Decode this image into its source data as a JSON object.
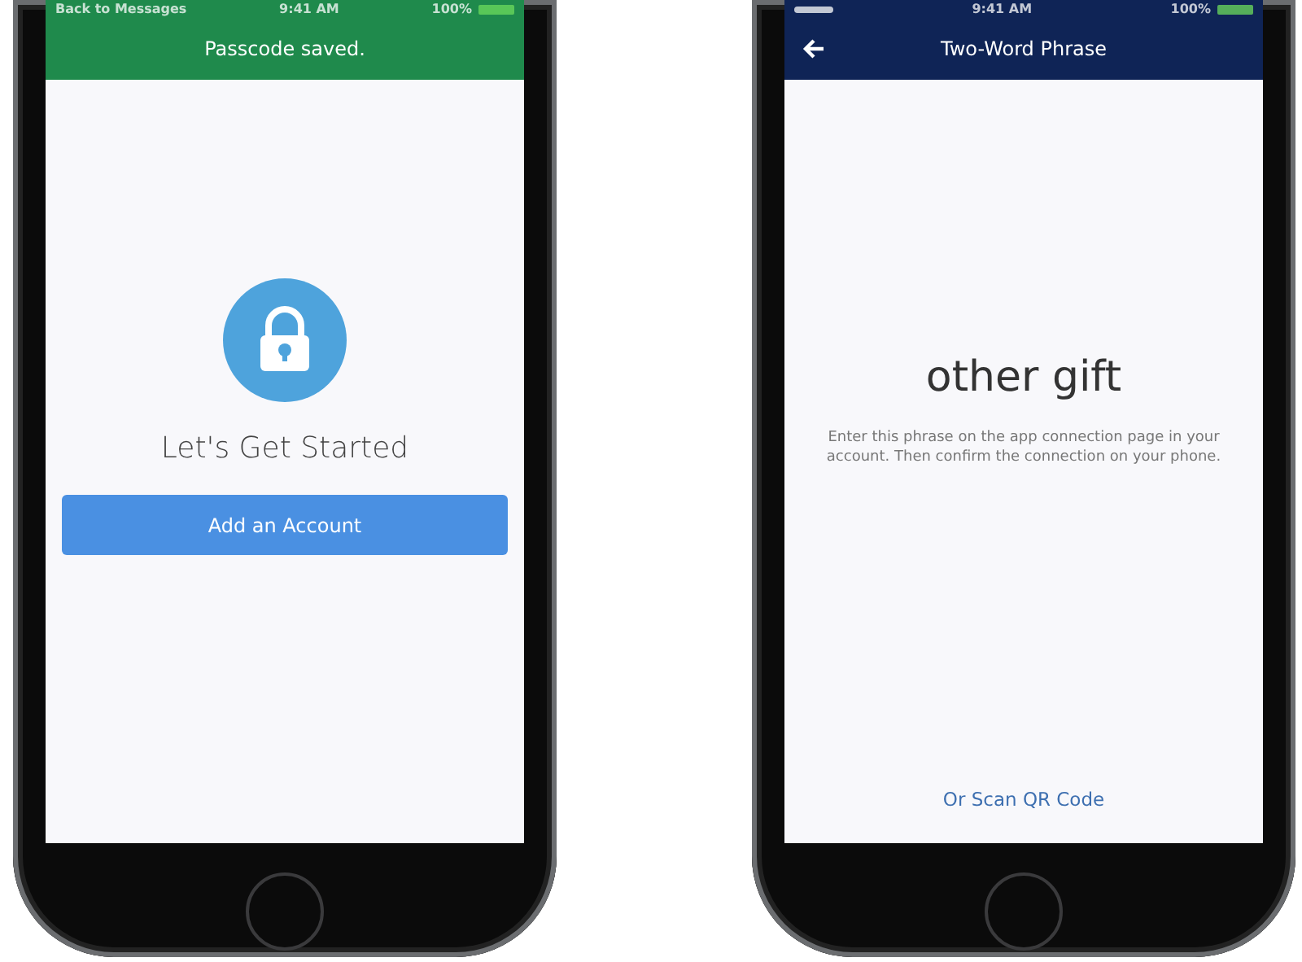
{
  "phones": [
    {
      "kind": "welcome",
      "status_bar": {
        "back": "Back to Messages",
        "time": "9:41 AM",
        "battery": "100%"
      },
      "header": {
        "title": "Passcode saved.",
        "color": "#1f8a4c"
      },
      "heading": "Let's Get Started",
      "button": "Add an Account"
    },
    {
      "kind": "phrase",
      "status_bar": {
        "time": "9:41 AM",
        "battery": "100%"
      },
      "header": {
        "title": "Two-Word Phrase",
        "color": "#0f2456",
        "back_arrow": true
      },
      "phrase": "other gift",
      "instructions": "Enter this phrase on the app connection page in your account. Then confirm the connection on your phone.",
      "link": "Or Scan QR Code"
    }
  ]
}
